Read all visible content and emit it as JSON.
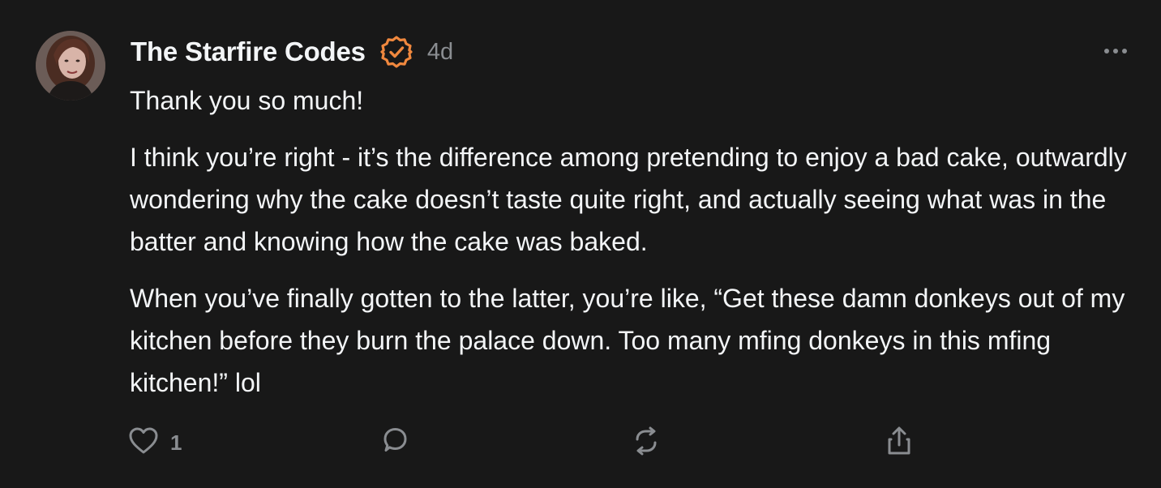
{
  "post": {
    "author": "The Starfire Codes",
    "verified": "verified-badge-icon",
    "time": "4d",
    "paragraphs": [
      "Thank you so much!",
      "I think you’re right - it’s the difference among pretending to enjoy a bad cake, outwardly wondering why the cake doesn’t taste quite right, and actually seeing what was in the batter and knowing how the cake was baked.",
      "When you’ve finally gotten to the latter, you’re like, “Get these damn donkeys out of my kitchen before they burn the palace down. Too many mfing donkeys in this mfing kitchen!” lol"
    ]
  },
  "actions": {
    "like_count": "1",
    "icons": [
      "heart-icon",
      "comment-icon",
      "repost-icon",
      "share-icon"
    ]
  },
  "colors": {
    "background": "#181818",
    "text": "#f3f5f7",
    "muted": "#8a8d91",
    "verified": "#f0883e"
  }
}
